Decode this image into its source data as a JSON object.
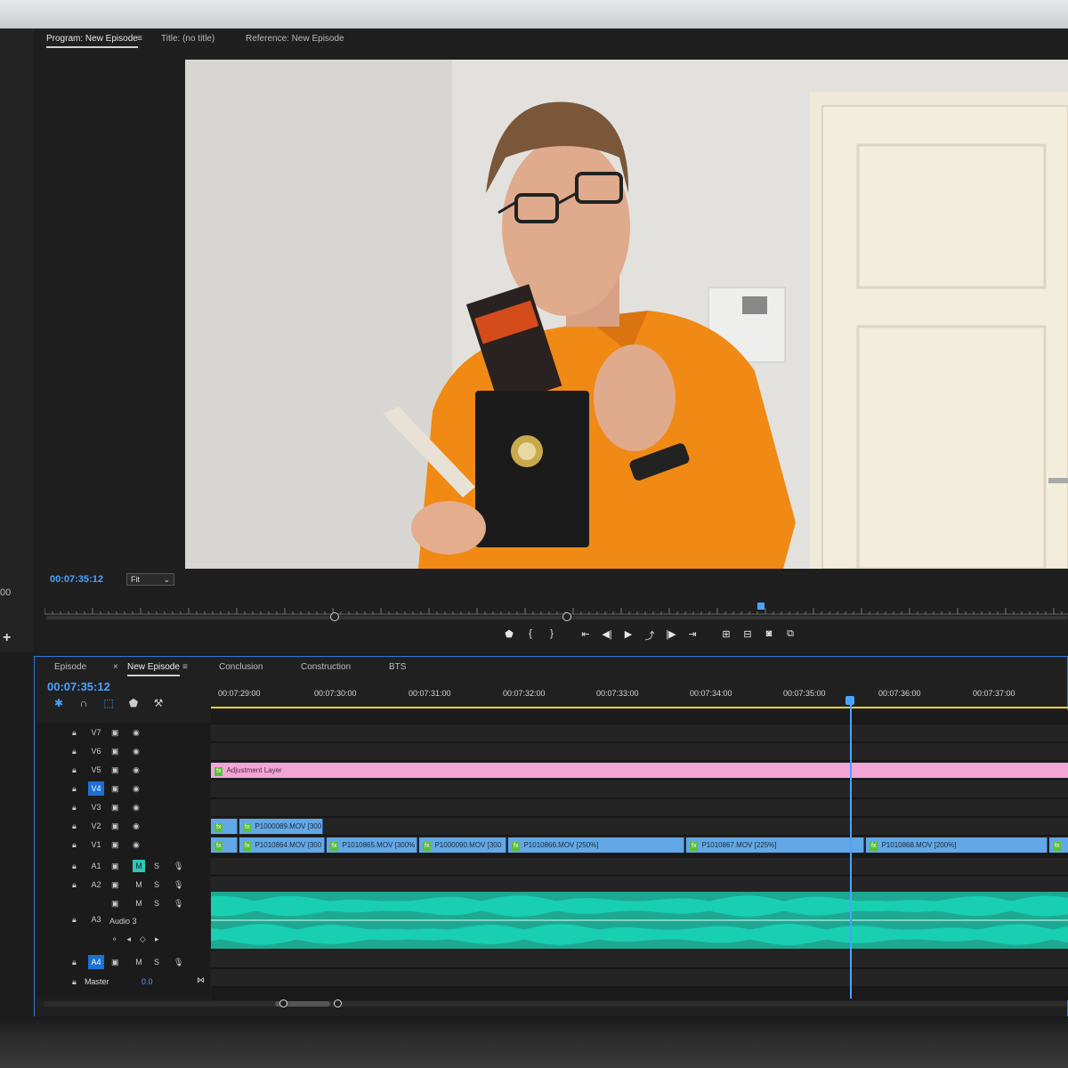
{
  "program": {
    "tabs": [
      "Program: New Episode",
      "Title: (no title)",
      "Reference: New Episode"
    ],
    "timecode": "00:07:35:12",
    "fit": "Fit",
    "transport_icons": [
      "marker-icon",
      "mark-in-icon",
      "mark-out-icon",
      "go-to-in-icon",
      "step-back-icon",
      "play-icon",
      "loop-icon",
      "step-forward-icon",
      "go-to-out-icon",
      "lift-icon",
      "extract-icon",
      "export-frame-icon",
      "button-editor-icon"
    ]
  },
  "left_strip": {
    "value": "00"
  },
  "timeline": {
    "tabs": [
      "Episode",
      "New Episode",
      "Conclusion",
      "Construction",
      "BTS"
    ],
    "close_glyph": "×",
    "timecode": "00:07:35:12",
    "ruler_labels": [
      "00:07:29:00",
      "00:07:30:00",
      "00:07:31:00",
      "00:07:32:00",
      "00:07:33:00",
      "00:07:34:00",
      "00:07:35:00",
      "00:07:36:00",
      "00:07:37:00"
    ],
    "video_tracks": [
      "V7",
      "V6",
      "V5",
      "V4",
      "V3",
      "V2",
      "V1"
    ],
    "audio_tracks": [
      "A1",
      "A2",
      "A3",
      "A4"
    ],
    "audio3_name": "Audio 3",
    "master": {
      "label": "Master",
      "value": "0.0"
    },
    "mute_label": "M",
    "solo_label": "S",
    "adjustment_layer": "Adjustment Layer",
    "v2_clips": [
      "",
      "P1000089.MOV [300"
    ],
    "v1_clips": [
      "",
      "P1010864.MOV [300",
      "P1010865.MOV [300%",
      "P1000090.MOV [300",
      "P1010866.MOV [250%]",
      "P1010867.MOV [225%]",
      "P1010868.MOV [200%]"
    ]
  },
  "colors": {
    "accent": "#4aa3ff",
    "audio": "#1ea892",
    "video_clip": "#62a8e6",
    "adjustment": "#f2a6d8",
    "work_area": "#e8d23c"
  }
}
